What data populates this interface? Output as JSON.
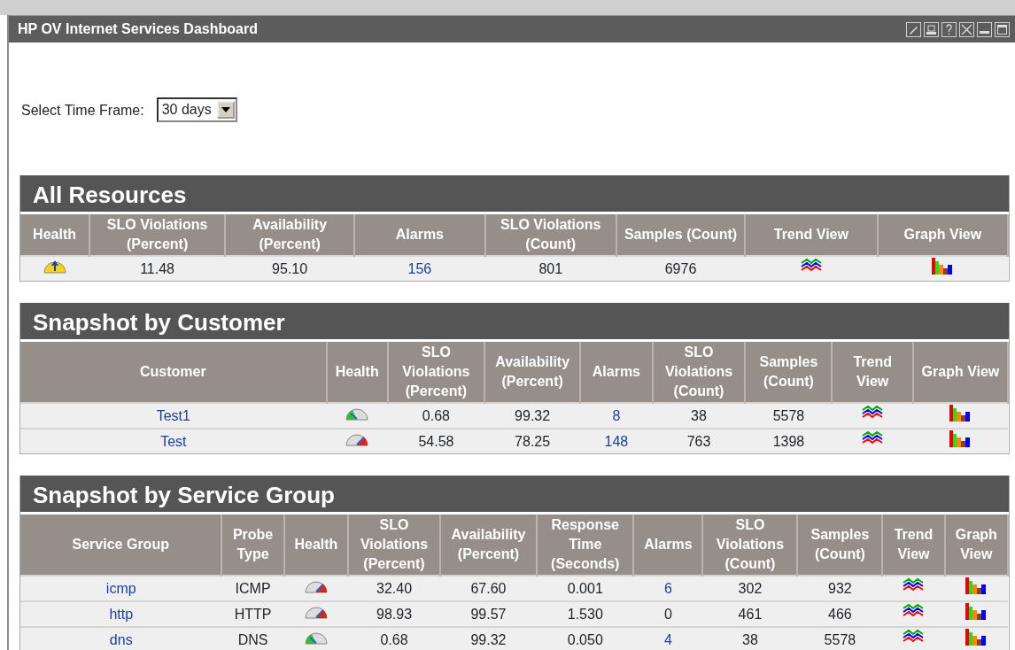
{
  "window": {
    "title": "HP OV Internet Services Dashboard",
    "tools": [
      {
        "kind": "edit"
      },
      {
        "kind": "print"
      },
      {
        "kind": "help"
      },
      {
        "kind": "close"
      },
      {
        "kind": "minimize"
      },
      {
        "kind": "maximize"
      }
    ]
  },
  "time_frame": {
    "label": "Select Time Frame:",
    "value": "30 days"
  },
  "sections": [
    {
      "title": "All Resources",
      "columns": [
        "Health",
        "SLO Violations (Percent)",
        "Availability (Percent)",
        "Alarms",
        "SLO Violations (Count)",
        "Samples (Count)",
        "Trend View",
        "Graph View"
      ],
      "rows": [
        [
          {
            "kind": "health",
            "color": "#f2d51c"
          },
          {
            "kind": "text",
            "text": "11.48"
          },
          {
            "kind": "text",
            "text": "95.10"
          },
          {
            "kind": "link",
            "text": "156"
          },
          {
            "kind": "text",
            "text": "801"
          },
          {
            "kind": "text",
            "text": "6976"
          },
          {
            "kind": "trend"
          },
          {
            "kind": "graph"
          }
        ]
      ]
    },
    {
      "title": "Snapshot by Customer",
      "columns": [
        "Customer",
        "Health",
        "SLO Violations (Percent)",
        "Availability (Percent)",
        "Alarms",
        "SLO Violations (Count)",
        "Samples (Count)",
        "Trend View",
        "Graph View"
      ],
      "rows": [
        [
          {
            "kind": "link",
            "text": "Test1"
          },
          {
            "kind": "health",
            "color": "#3cb83c"
          },
          {
            "kind": "text",
            "text": "0.68"
          },
          {
            "kind": "text",
            "text": "99.32"
          },
          {
            "kind": "link",
            "text": "8"
          },
          {
            "kind": "text",
            "text": "38"
          },
          {
            "kind": "text",
            "text": "5578"
          },
          {
            "kind": "trend"
          },
          {
            "kind": "graph"
          }
        ],
        [
          {
            "kind": "link",
            "text": "Test"
          },
          {
            "kind": "health",
            "color": "#d9241f"
          },
          {
            "kind": "text",
            "text": "54.58"
          },
          {
            "kind": "text",
            "text": "78.25"
          },
          {
            "kind": "link",
            "text": "148"
          },
          {
            "kind": "text",
            "text": "763"
          },
          {
            "kind": "text",
            "text": "1398"
          },
          {
            "kind": "trend"
          },
          {
            "kind": "graph"
          }
        ]
      ]
    },
    {
      "title": "Snapshot by Service Group",
      "columns": [
        "Service Group",
        "Probe Type",
        "Health",
        "SLO Violations (Percent)",
        "Availability (Percent)",
        "Response Time (Seconds)",
        "Alarms",
        "SLO Violations (Count)",
        "Samples (Count)",
        "Trend View",
        "Graph View"
      ],
      "rows": [
        [
          {
            "kind": "link",
            "text": "icmp"
          },
          {
            "kind": "text",
            "text": "ICMP"
          },
          {
            "kind": "health",
            "color": "#d9241f"
          },
          {
            "kind": "text",
            "text": "32.40"
          },
          {
            "kind": "text",
            "text": "67.60"
          },
          {
            "kind": "text",
            "text": "0.001"
          },
          {
            "kind": "link",
            "text": "6"
          },
          {
            "kind": "text",
            "text": "302"
          },
          {
            "kind": "text",
            "text": "932"
          },
          {
            "kind": "trend"
          },
          {
            "kind": "graph"
          }
        ],
        [
          {
            "kind": "link",
            "text": "http"
          },
          {
            "kind": "text",
            "text": "HTTP"
          },
          {
            "kind": "health",
            "color": "#d9241f"
          },
          {
            "kind": "text",
            "text": "98.93"
          },
          {
            "kind": "text",
            "text": "99.57"
          },
          {
            "kind": "text",
            "text": "1.530"
          },
          {
            "kind": "text",
            "text": "0"
          },
          {
            "kind": "text",
            "text": "461"
          },
          {
            "kind": "text",
            "text": "466"
          },
          {
            "kind": "trend"
          },
          {
            "kind": "graph"
          }
        ],
        [
          {
            "kind": "link",
            "text": "dns"
          },
          {
            "kind": "text",
            "text": "DNS"
          },
          {
            "kind": "health",
            "color": "#3cb83c"
          },
          {
            "kind": "text",
            "text": "0.68"
          },
          {
            "kind": "text",
            "text": "99.32"
          },
          {
            "kind": "text",
            "text": "0.050"
          },
          {
            "kind": "link",
            "text": "4"
          },
          {
            "kind": "text",
            "text": "38"
          },
          {
            "kind": "text",
            "text": "5578"
          },
          {
            "kind": "trend"
          },
          {
            "kind": "graph"
          }
        ]
      ]
    }
  ]
}
